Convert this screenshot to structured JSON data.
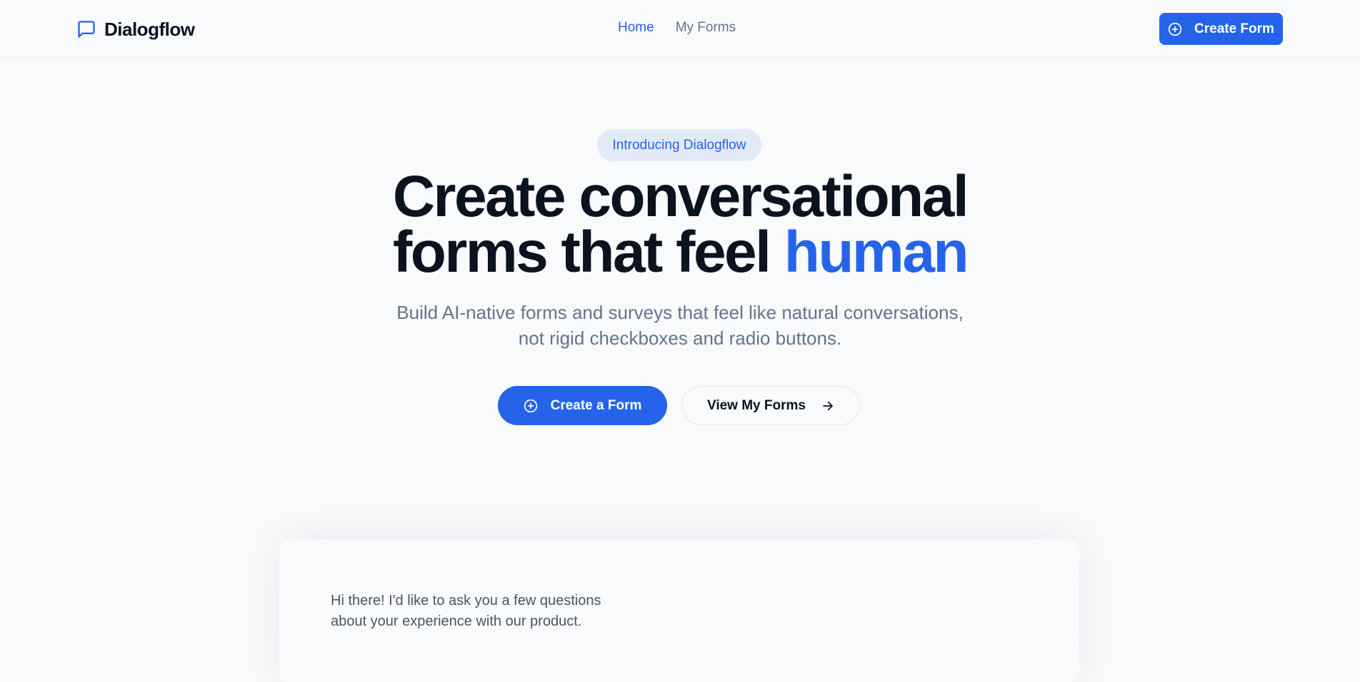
{
  "brand": {
    "name": "Dialogflow",
    "icon": "message-square-icon"
  },
  "nav": {
    "links": [
      {
        "label": "Home",
        "active": true
      },
      {
        "label": "My Forms",
        "active": false
      }
    ],
    "create_button": {
      "label": "Create Form",
      "icon": "plus-circle-icon"
    }
  },
  "hero": {
    "badge": "Introducing Dialogflow",
    "headline_line1": "Create conversational",
    "headline_line2_plain": "forms that feel ",
    "headline_line2_accent": "human",
    "subtitle_line1": "Build AI-native forms and surveys that feel like natural conversations,",
    "subtitle_line2": "not rigid checkboxes and radio buttons.",
    "primary_cta": {
      "label": "Create a Form",
      "icon": "plus-circle-icon"
    },
    "secondary_cta": {
      "label": "View My Forms",
      "icon": "arrow-right-icon"
    }
  },
  "preview": {
    "message_line1": "Hi there! I'd like to ask you a few questions",
    "message_line2": "about your experience with our product."
  },
  "colors": {
    "accent": "#2563eb",
    "background": "#f8fafc",
    "text": "#0b1220",
    "muted": "#64748b",
    "badge_bg": "#e3eaf7"
  }
}
